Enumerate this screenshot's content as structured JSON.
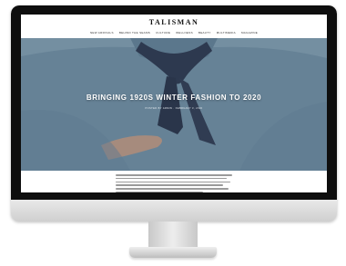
{
  "site": {
    "logo": "TALISMAN",
    "nav": [
      "NEW ARRIVALS",
      "BEHIND THE SEAMS",
      "CULTURE",
      "WELLNESS",
      "BEAUTY",
      "MULTIMEDIA",
      "MAGAZINE"
    ]
  },
  "hero": {
    "title": "BRINGING 1920S WINTER FASHION TO 2020",
    "meta": "POSTED BY ADMIN  ·  FEBRUARY 3, 2020"
  },
  "colors": {
    "shirt": "#7d9db4",
    "bandana": "#2f3a52",
    "bezel": "#0e0e0e"
  }
}
